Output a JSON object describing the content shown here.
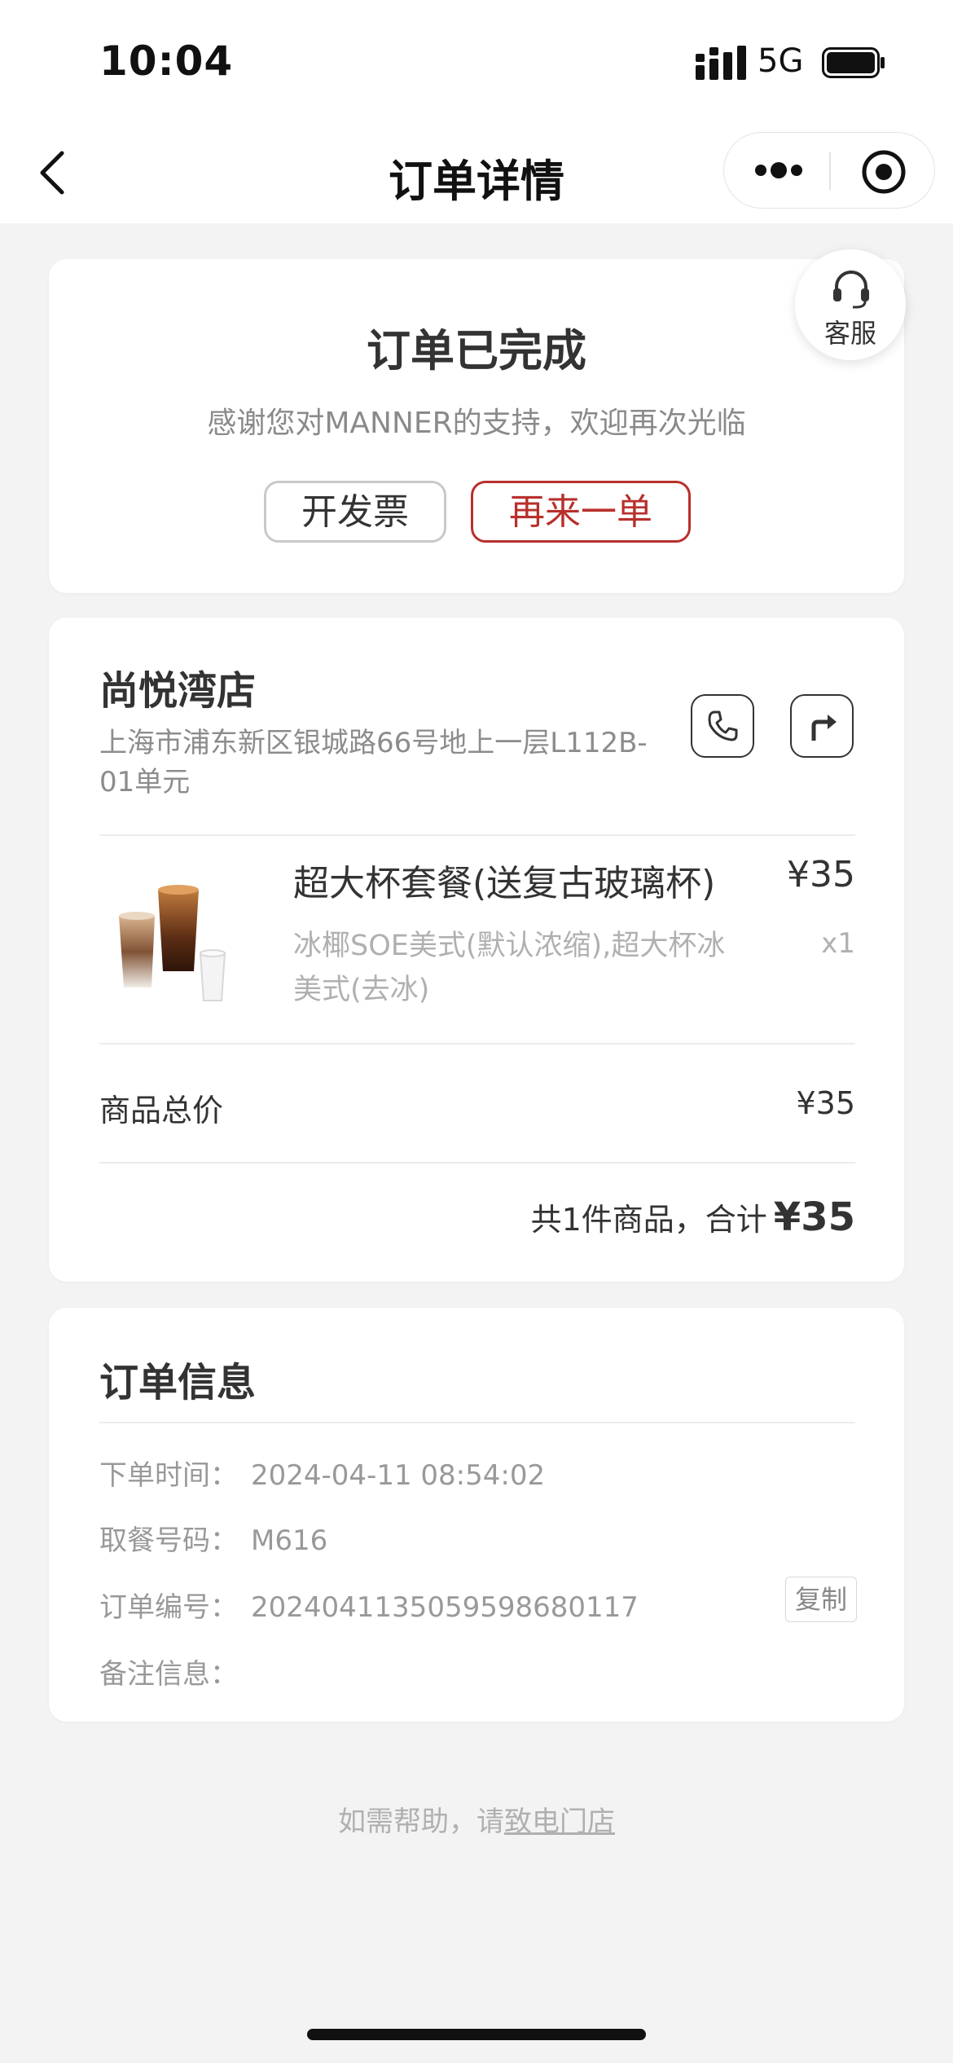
{
  "status_bar": {
    "time": "10:04",
    "network": "5G"
  },
  "nav": {
    "title": "订单详情"
  },
  "order_status": {
    "title": "订单已完成",
    "subtitle": "感谢您对MANNER的支持，欢迎再次光临",
    "invoice_label": "开发票",
    "reorder_label": "再来一单",
    "service_label": "客服"
  },
  "store": {
    "name": "尚悦湾店",
    "address": "上海市浦东新区银城路66号地上一层L112B-01单元"
  },
  "product": {
    "name": "超大杯套餐(送复古玻璃杯)",
    "price": "¥35",
    "options": "冰椰SOE美式(默认浓缩),超大杯冰美式(去冰)",
    "quantity": "x1"
  },
  "summary": {
    "subtotal_label": "商品总价",
    "subtotal_value": "¥35",
    "total_prefix": "共1件商品，合计",
    "total_value": "¥35"
  },
  "order_info": {
    "title": "订单信息",
    "rows": [
      {
        "label": "下单时间：",
        "value": "2024-04-11 08:54:02"
      },
      {
        "label": "取餐号码：",
        "value": "M616"
      },
      {
        "label": "订单编号：",
        "value": "20240411350595986801​17"
      },
      {
        "label": "备注信息：",
        "value": ""
      }
    ],
    "copy_label": "复制"
  },
  "help": {
    "prefix": "如需帮助，请",
    "link": "致电门店"
  },
  "colors": {
    "accent": "#b8302c",
    "background": "#f3f3f3"
  }
}
